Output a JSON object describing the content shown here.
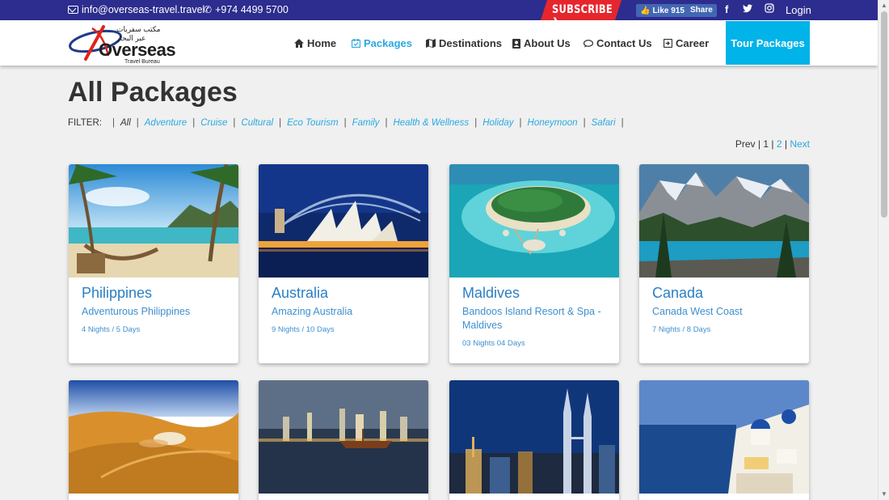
{
  "topbar": {
    "email": "info@overseas-travel.travel",
    "phone": "+974 4499 5700",
    "subscribe": "SUBSCRIBE",
    "fb_like": "Like 915",
    "fb_share": "Share",
    "login": "Login"
  },
  "logo": {
    "arabic": "مكتب سفريات عبر البحار",
    "name": "Overseas",
    "sub": "Travel Bureau"
  },
  "nav": {
    "items": [
      {
        "label": "Home",
        "icon": "home-icon"
      },
      {
        "label": "Packages",
        "icon": "calendar-icon"
      },
      {
        "label": "Destinations",
        "icon": "map-icon"
      },
      {
        "label": "About Us",
        "icon": "user-badge-icon"
      },
      {
        "label": "Contact Us",
        "icon": "chat-icon"
      },
      {
        "label": "Career",
        "icon": "signin-icon"
      }
    ],
    "cta": "Tour Packages"
  },
  "page": {
    "title": "All Packages",
    "filter_label": "FILTER:",
    "filters": [
      "All",
      "Adventure",
      "Cruise",
      "Cultural",
      "Eco Tourism",
      "Family",
      "Health & Wellness",
      "Holiday",
      "Honeymoon",
      "Safari"
    ],
    "pagination": {
      "prev": "Prev",
      "p1": "1",
      "p2": "2",
      "next": "Next"
    }
  },
  "cards": [
    {
      "destination": "Philippines",
      "package": "Adventurous Philippines",
      "duration": "4 Nights / 5 Days"
    },
    {
      "destination": "Australia",
      "package": "Amazing Australia",
      "duration": "9 Nights / 10 Days"
    },
    {
      "destination": "Maldives",
      "package": "Bandoos Island Resort & Spa - Maldives",
      "duration": "03 Nights 04 Days"
    },
    {
      "destination": "Canada",
      "package": "Canada West Coast",
      "duration": "7 Nights / 8 Days"
    }
  ]
}
